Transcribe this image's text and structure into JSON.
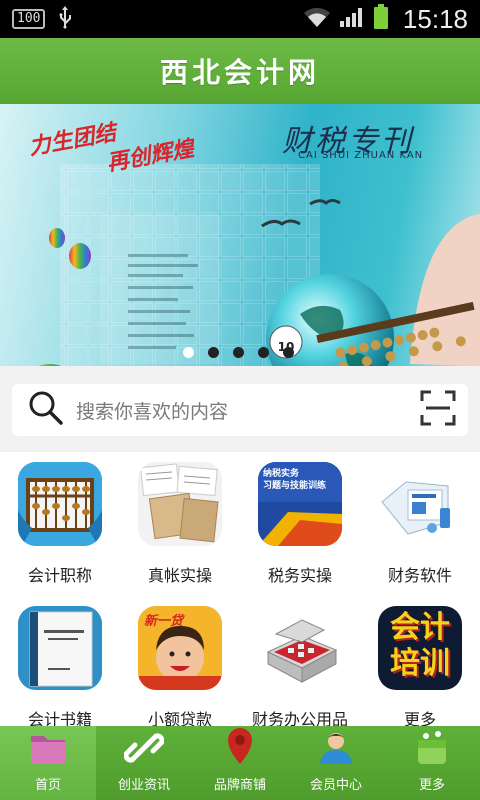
{
  "status_bar": {
    "battery_text": "100",
    "time": "15:18"
  },
  "header": {
    "title": "西北会计网"
  },
  "banner": {
    "slogan_line1": "力生团结",
    "slogan_line2": "再创辉煌",
    "title_cn": "财税专刊",
    "title_pinyin": "CAI SHUI ZHUAN KAN",
    "issue_number": "10",
    "carousel": {
      "total": 5,
      "active": 1
    }
  },
  "search": {
    "placeholder": "搜索你喜欢的内容"
  },
  "grid": {
    "items": [
      {
        "label": "会计职称",
        "icon": "abacus-icon"
      },
      {
        "label": "真帐实操",
        "icon": "ledger-papers-icon"
      },
      {
        "label": "税务实操",
        "icon": "tax-book-icon",
        "text": "纳税实务\n习题与技能训练"
      },
      {
        "label": "财务软件",
        "icon": "software-box-icon"
      },
      {
        "label": "会计书籍",
        "icon": "accounting-book-icon"
      },
      {
        "label": "小额贷款",
        "icon": "microloan-icon",
        "text": "新一贷"
      },
      {
        "label": "财务办公用品",
        "icon": "seal-box-icon"
      },
      {
        "label": "更多",
        "icon": "accounting-training-icon",
        "text": "会计\n培训"
      }
    ]
  },
  "tabbar": {
    "tabs": [
      {
        "label": "首页",
        "icon": "folder-icon",
        "active": true
      },
      {
        "label": "创业资讯",
        "icon": "link-icon",
        "active": false
      },
      {
        "label": "品牌商铺",
        "icon": "location-pin-icon",
        "active": false
      },
      {
        "label": "会员中心",
        "icon": "user-icon",
        "active": false
      },
      {
        "label": "更多",
        "icon": "more-icon",
        "active": false
      }
    ]
  },
  "colors": {
    "brand_green": "#5aa936",
    "banner_teal": "#2fb3c9",
    "slogan_red": "#d8262c"
  }
}
